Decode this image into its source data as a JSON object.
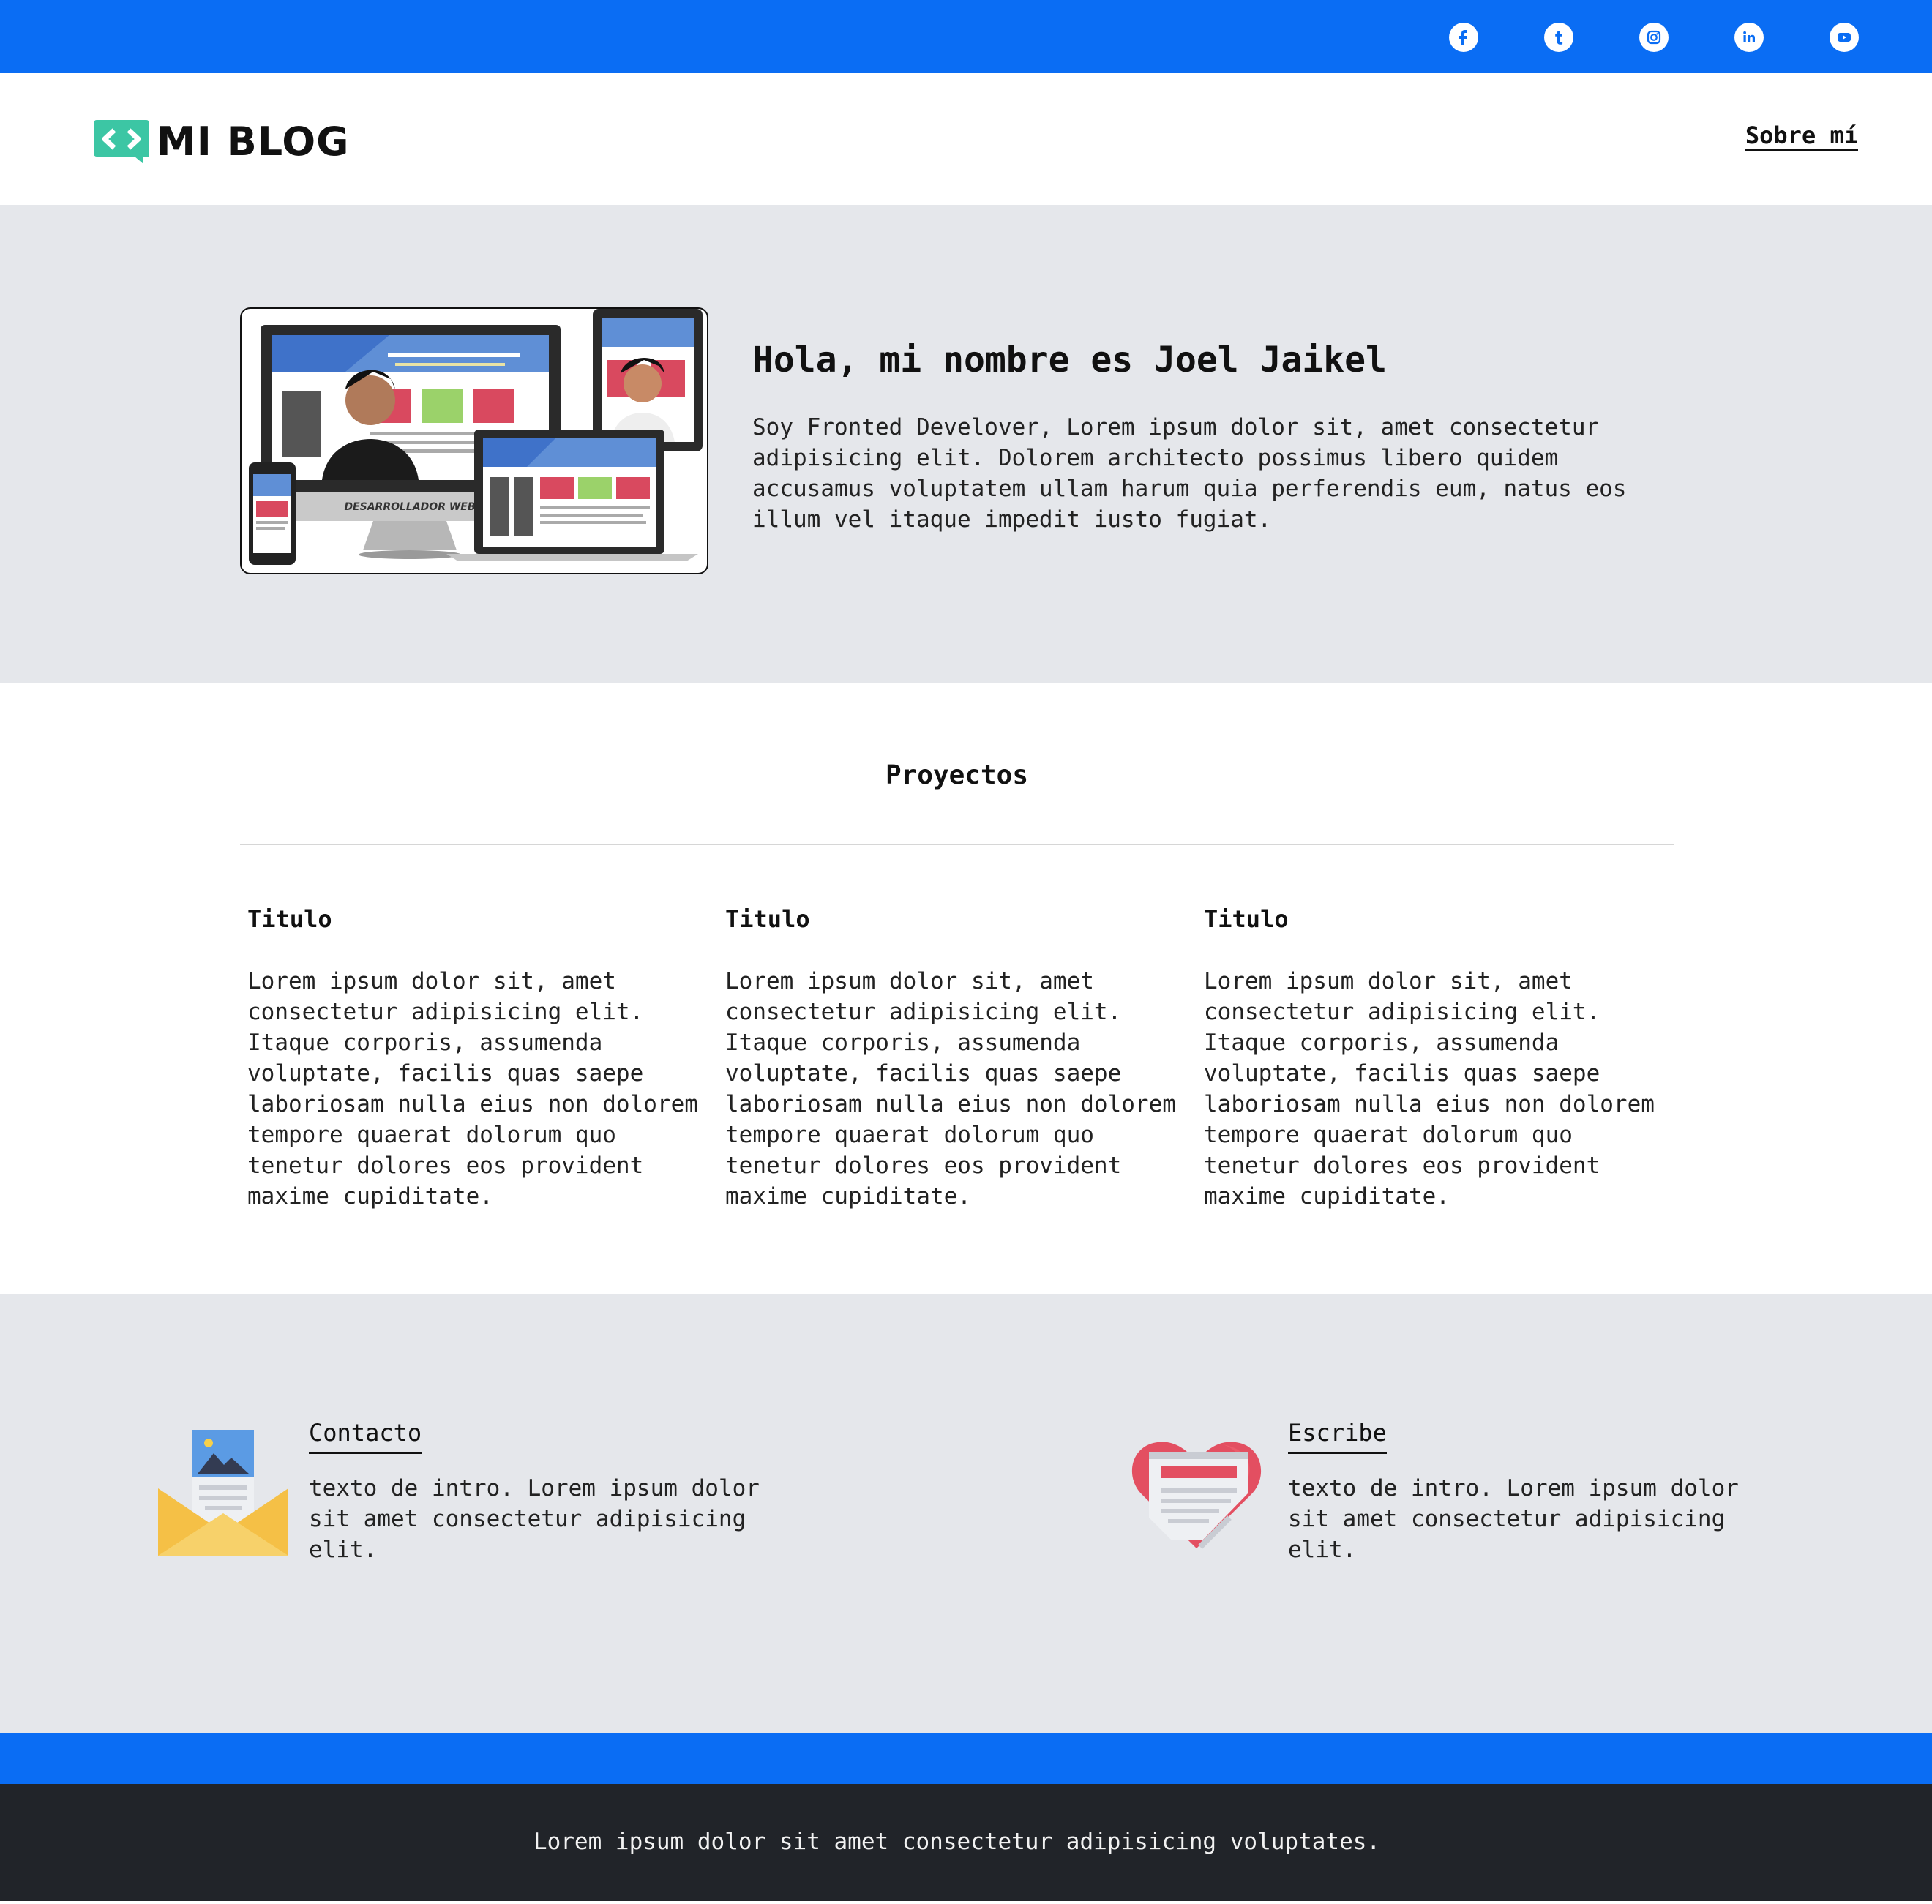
{
  "colors": {
    "primary": "#0a6df4",
    "surface": "#e5e7eb",
    "footer": "#212429",
    "logo_accent": "#3cc6a4"
  },
  "social": [
    {
      "name": "facebook",
      "icon": "facebook-icon"
    },
    {
      "name": "tumblr",
      "icon": "tumblr-icon"
    },
    {
      "name": "instagram",
      "icon": "instagram-icon"
    },
    {
      "name": "linkedin",
      "icon": "linkedin-icon"
    },
    {
      "name": "youtube",
      "icon": "youtube-icon"
    }
  ],
  "header": {
    "logo_text": "MI BLOG",
    "nav_about": "Sobre mí"
  },
  "hero": {
    "image_caption": "DESARROLLADOR WEB",
    "title": "Hola, mi nombre es Joel Jaikel",
    "text": "Soy Fronted Develover, Lorem ipsum dolor sit, amet consectetur adipisicing elit. Dolorem architecto possimus libero quidem accusamus voluptatem ullam harum quia perferendis eum, natus eos illum vel itaque impedit iusto fugiat."
  },
  "projects": {
    "title": "Proyectos",
    "items": [
      {
        "title": "Titulo",
        "text": "Lorem ipsum dolor sit, amet consectetur adipisicing elit. Itaque corporis, assumenda voluptate, facilis quas saepe laboriosam nulla eius non dolorem tempore quaerat dolorum quo tenetur dolores eos provident maxime cupiditate."
      },
      {
        "title": "Titulo",
        "text": "Lorem ipsum dolor sit, amet consectetur adipisicing elit. Itaque corporis, assumenda voluptate, facilis quas saepe laboriosam nulla eius non dolorem tempore quaerat dolorum quo tenetur dolores eos provident maxime cupiditate."
      },
      {
        "title": "Titulo",
        "text": "Lorem ipsum dolor sit, amet consectetur adipisicing elit. Itaque corporis, assumenda voluptate, facilis quas saepe laboriosam nulla eius non dolorem tempore quaerat dolorum quo tenetur dolores eos provident maxime cupiditate."
      }
    ]
  },
  "features": [
    {
      "title": "Contacto",
      "text": "texto de intro. Lorem ipsum dolor sit amet consectetur adipisicing elit.",
      "icon": "mail-envelope-icon"
    },
    {
      "title": "Escribe",
      "text": "texto de intro. Lorem ipsum dolor sit amet consectetur adipisicing elit.",
      "icon": "heart-document-icon"
    }
  ],
  "footer": {
    "text": "Lorem ipsum dolor sit amet consectetur adipisicing voluptates."
  }
}
